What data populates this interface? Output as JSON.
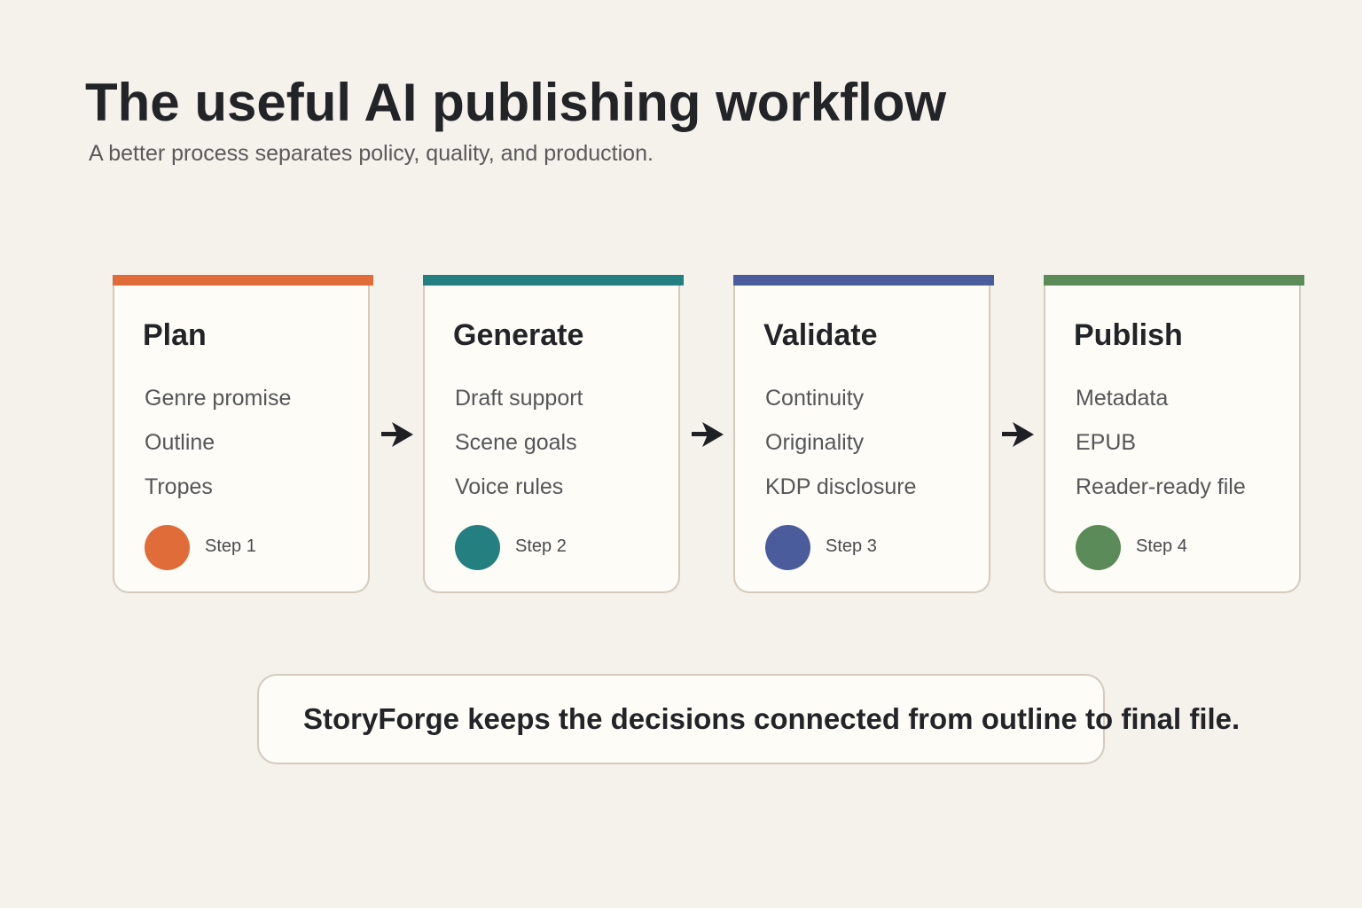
{
  "header": {
    "title": "The useful AI publishing workflow",
    "subtitle": "A better process separates policy, quality, and production."
  },
  "steps": [
    {
      "title": "Plan",
      "items": [
        "Genre promise",
        "Outline",
        "Tropes"
      ],
      "step_label": "Step 1",
      "color": "#e06c3a"
    },
    {
      "title": "Generate",
      "items": [
        "Draft support",
        "Scene goals",
        "Voice rules"
      ],
      "step_label": "Step 2",
      "color": "#237f80"
    },
    {
      "title": "Validate",
      "items": [
        "Continuity",
        "Originality",
        "KDP disclosure"
      ],
      "step_label": "Step 3",
      "color": "#4a5c9c"
    },
    {
      "title": "Publish",
      "items": [
        "Metadata",
        "EPUB",
        "Reader-ready file"
      ],
      "step_label": "Step 4",
      "color": "#5a8b58"
    }
  ],
  "callout": {
    "text": "StoryForge keeps the decisions connected from outline to final file."
  }
}
